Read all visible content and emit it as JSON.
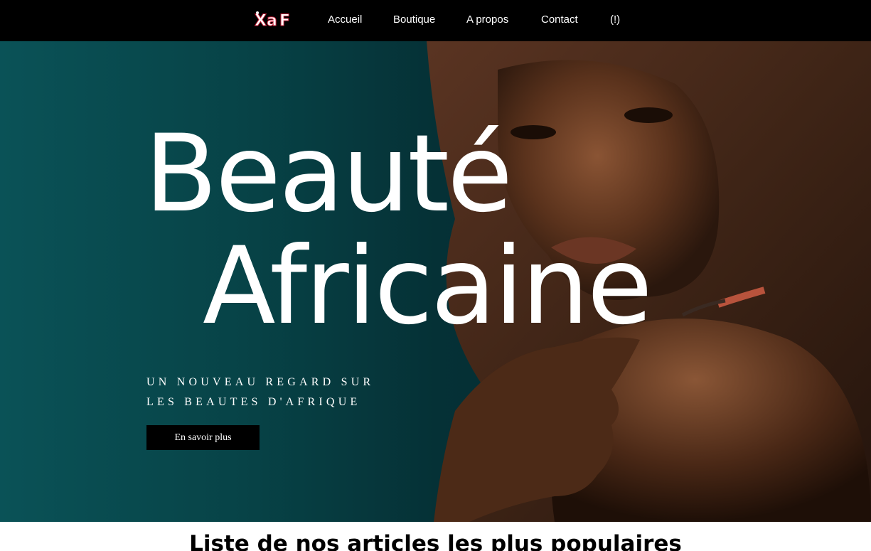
{
  "nav": {
    "logo_text": "XaF",
    "links": [
      {
        "label": "Accueil"
      },
      {
        "label": "Boutique"
      },
      {
        "label": "A propos"
      },
      {
        "label": "Contact"
      },
      {
        "label": "(!)"
      }
    ]
  },
  "hero": {
    "title_line1": "Beauté",
    "title_line2": "Africaine",
    "subtitle_line1": "UN NOUVEAU REGARD SUR",
    "subtitle_line2": "LES BEAUTES D'AFRIQUE",
    "cta_label": "En savoir plus"
  },
  "section": {
    "title": "Liste de nos articles les plus populaires"
  },
  "colors": {
    "nav_bg": "#000000",
    "hero_teal": "#0a5257",
    "button_bg": "#000000",
    "text_light": "#ffffff"
  }
}
